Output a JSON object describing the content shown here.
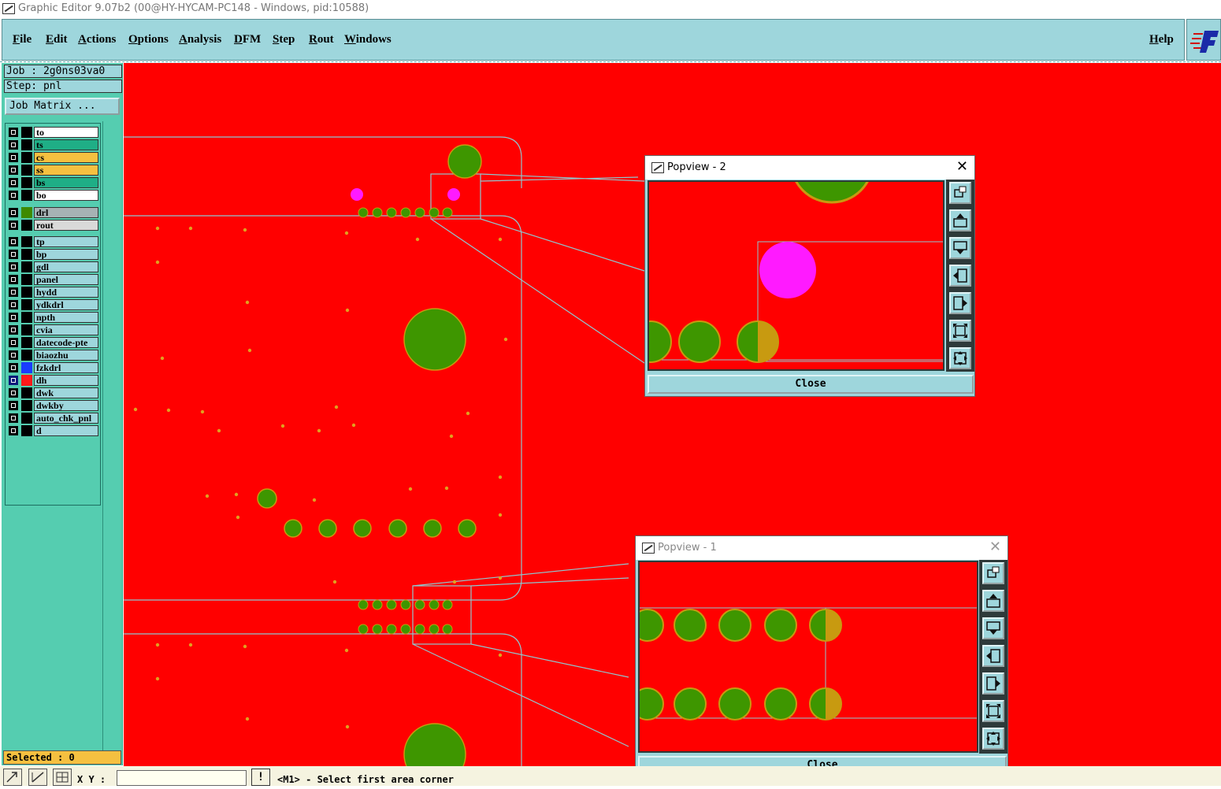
{
  "window": {
    "title": "Graphic Editor 9.07b2 (00@HY-HYCAM-PC148 - Windows, pid:10588)"
  },
  "menu": {
    "items": [
      "File",
      "Edit",
      "Actions",
      "Options",
      "Analysis",
      "DFM",
      "Step",
      "Rout",
      "Windows"
    ],
    "help": "Help"
  },
  "job": {
    "job_label": "Job : 2g0ns03va0",
    "step_label": "Step: pnl",
    "matrix_button": "Job Matrix ..."
  },
  "layers": [
    {
      "name": "to",
      "color": "#ffffff"
    },
    {
      "name": "ts",
      "color": "#1fae86"
    },
    {
      "name": "cs",
      "color": "#f5c040"
    },
    {
      "name": "ss",
      "color": "#f5c040"
    },
    {
      "name": "bs",
      "color": "#1fae86"
    },
    {
      "name": "bo",
      "color": "#ffffff"
    },
    {
      "name": "drl",
      "color": "#a6b2b4",
      "swatch": "#3e8a00"
    },
    {
      "name": "rout",
      "color": "#d9d9d9"
    },
    {
      "name": "tp",
      "color": "#9ed6dc"
    },
    {
      "name": "bp",
      "color": "#9ed6dc"
    },
    {
      "name": "gdl",
      "color": "#9ed6dc"
    },
    {
      "name": "panel",
      "color": "#9ed6dc"
    },
    {
      "name": "hydd",
      "color": "#9ed6dc"
    },
    {
      "name": "ydkdrl",
      "color": "#9ed6dc"
    },
    {
      "name": "npth",
      "color": "#9ed6dc"
    },
    {
      "name": "cvia",
      "color": "#9ed6dc"
    },
    {
      "name": "datecode-pte",
      "color": "#9ed6dc"
    },
    {
      "name": "biaozhu",
      "color": "#9ed6dc"
    },
    {
      "name": "fzkdrl",
      "color": "#9ed6dc",
      "swatch": "#1a3cff"
    },
    {
      "name": "dh",
      "color": "#9ed6dc",
      "swatch": "#ff1a1a",
      "active": true
    },
    {
      "name": "dwk",
      "color": "#9ed6dc"
    },
    {
      "name": "dwkby",
      "color": "#9ed6dc"
    },
    {
      "name": "auto_chk_pnl",
      "color": "#9ed6dc"
    },
    {
      "name": "d",
      "color": "#9ed6dc"
    }
  ],
  "status": {
    "selected": "Selected : 0",
    "xy_label": "X Y :",
    "xy_value": "",
    "excl": "!",
    "prompt": "<M1> - Select first area corner"
  },
  "popview2": {
    "title": "Popview - 2",
    "close_label": "Close"
  },
  "popview1": {
    "title": "Popview - 1",
    "close_label": "Close"
  },
  "colors": {
    "canvas": "#ff0000",
    "pad": "#3e9600",
    "pad_outline": "#c89a10",
    "magenta": "#ff1aff",
    "outline": "#8fc7cf",
    "menu_bg": "#9ed6dc",
    "panel_bg": "#55cdb0"
  }
}
